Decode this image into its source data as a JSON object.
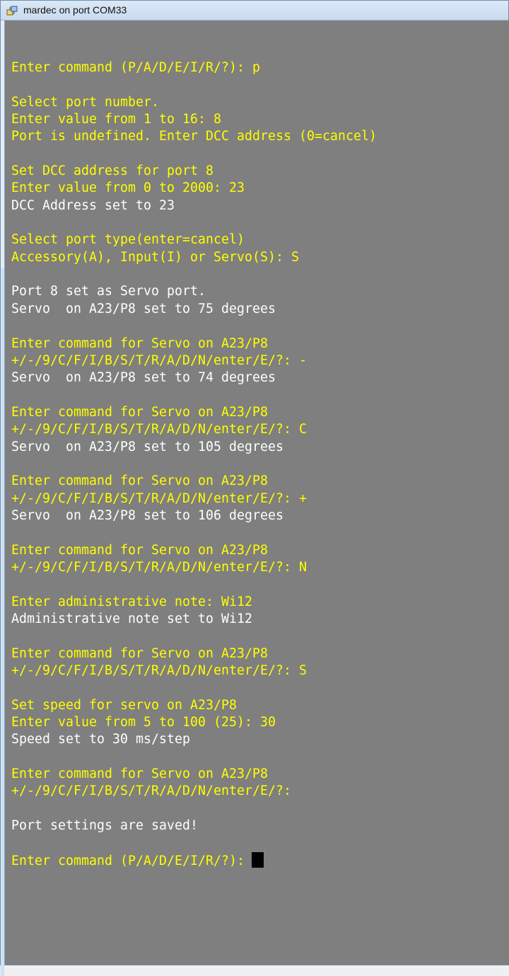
{
  "window": {
    "title": "mardec on port COM33"
  },
  "colors": {
    "background": "#7f7f7f",
    "prompt": "#ffff00",
    "output": "#ffffff",
    "cursor": "#000000"
  },
  "console": {
    "lines": [
      {
        "text": "Enter command (P/A/D/E/I/R/?): p",
        "color": "yellow"
      },
      {
        "text": "",
        "color": "yellow"
      },
      {
        "text": "Select port number.",
        "color": "yellow"
      },
      {
        "text": "Enter value from 1 to 16: 8",
        "color": "yellow"
      },
      {
        "text": "Port is undefined. Enter DCC address (0=cancel)",
        "color": "yellow"
      },
      {
        "text": "",
        "color": "yellow"
      },
      {
        "text": "Set DCC address for port 8",
        "color": "yellow"
      },
      {
        "text": "Enter value from 0 to 2000: 23",
        "color": "yellow"
      },
      {
        "text": "DCC Address set to 23",
        "color": "white"
      },
      {
        "text": "",
        "color": "white"
      },
      {
        "text": "Select port type(enter=cancel)",
        "color": "yellow"
      },
      {
        "text": "Accessory(A), Input(I) or Servo(S): S",
        "color": "yellow"
      },
      {
        "text": "",
        "color": "white"
      },
      {
        "text": "Port 8 set as Servo port.",
        "color": "white"
      },
      {
        "text": "Servo  on A23/P8 set to 75 degrees",
        "color": "white"
      },
      {
        "text": "",
        "color": "white"
      },
      {
        "text": "Enter command for Servo on A23/P8",
        "color": "yellow"
      },
      {
        "text": "+/-/9/C/F/I/B/S/T/R/A/D/N/enter/E/?: -",
        "color": "yellow"
      },
      {
        "text": "Servo  on A23/P8 set to 74 degrees",
        "color": "white"
      },
      {
        "text": "",
        "color": "white"
      },
      {
        "text": "Enter command for Servo on A23/P8",
        "color": "yellow"
      },
      {
        "text": "+/-/9/C/F/I/B/S/T/R/A/D/N/enter/E/?: C",
        "color": "yellow"
      },
      {
        "text": "Servo  on A23/P8 set to 105 degrees",
        "color": "white"
      },
      {
        "text": "",
        "color": "white"
      },
      {
        "text": "Enter command for Servo on A23/P8",
        "color": "yellow"
      },
      {
        "text": "+/-/9/C/F/I/B/S/T/R/A/D/N/enter/E/?: +",
        "color": "yellow"
      },
      {
        "text": "Servo  on A23/P8 set to 106 degrees",
        "color": "white"
      },
      {
        "text": "",
        "color": "white"
      },
      {
        "text": "Enter command for Servo on A23/P8",
        "color": "yellow"
      },
      {
        "text": "+/-/9/C/F/I/B/S/T/R/A/D/N/enter/E/?: N",
        "color": "yellow"
      },
      {
        "text": "",
        "color": "white"
      },
      {
        "text": "Enter administrative note: Wi12",
        "color": "yellow"
      },
      {
        "text": "Administrative note set to Wi12",
        "color": "white"
      },
      {
        "text": "",
        "color": "white"
      },
      {
        "text": "Enter command for Servo on A23/P8",
        "color": "yellow"
      },
      {
        "text": "+/-/9/C/F/I/B/S/T/R/A/D/N/enter/E/?: S",
        "color": "yellow"
      },
      {
        "text": "",
        "color": "white"
      },
      {
        "text": "Set speed for servo on A23/P8",
        "color": "yellow"
      },
      {
        "text": "Enter value from 5 to 100 (25): 30",
        "color": "yellow"
      },
      {
        "text": "Speed set to 30 ms/step",
        "color": "white"
      },
      {
        "text": "",
        "color": "white"
      },
      {
        "text": "Enter command for Servo on A23/P8",
        "color": "yellow"
      },
      {
        "text": "+/-/9/C/F/I/B/S/T/R/A/D/N/enter/E/?:",
        "color": "yellow"
      },
      {
        "text": "",
        "color": "white"
      },
      {
        "text": "Port settings are saved!",
        "color": "white"
      },
      {
        "text": "",
        "color": "white"
      },
      {
        "text": "Enter command (P/A/D/E/I/R/?):",
        "color": "yellow",
        "cursor": true
      }
    ]
  }
}
